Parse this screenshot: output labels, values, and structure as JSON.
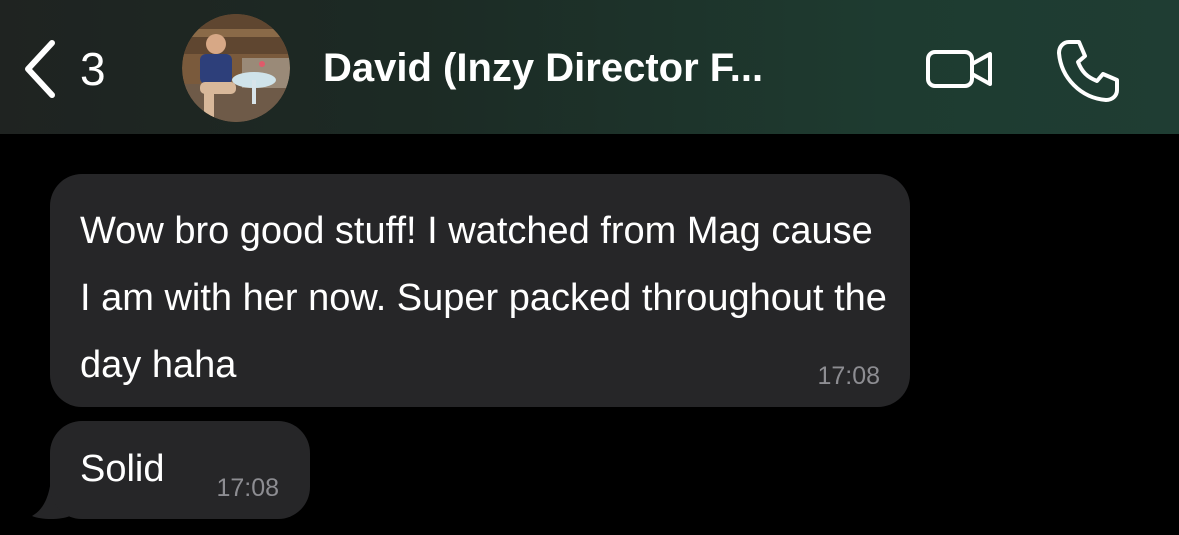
{
  "header": {
    "back_count": "3",
    "contact_name": "David (Inzy Director F...",
    "back_icon": "chevron-left-icon",
    "video_icon": "video-camera-icon",
    "call_icon": "phone-icon"
  },
  "messages": [
    {
      "text": "Wow bro good stuff! I watched from Mag cause I am with her now. Super packed throughout the day haha",
      "time": "17:08"
    },
    {
      "text": "Solid",
      "time": "17:08"
    }
  ],
  "colors": {
    "header_gradient_start": "#1f2321",
    "header_gradient_end": "#1f3d33",
    "bubble_incoming": "#262628",
    "timestamp": "#8d8d92",
    "background": "#000000"
  }
}
